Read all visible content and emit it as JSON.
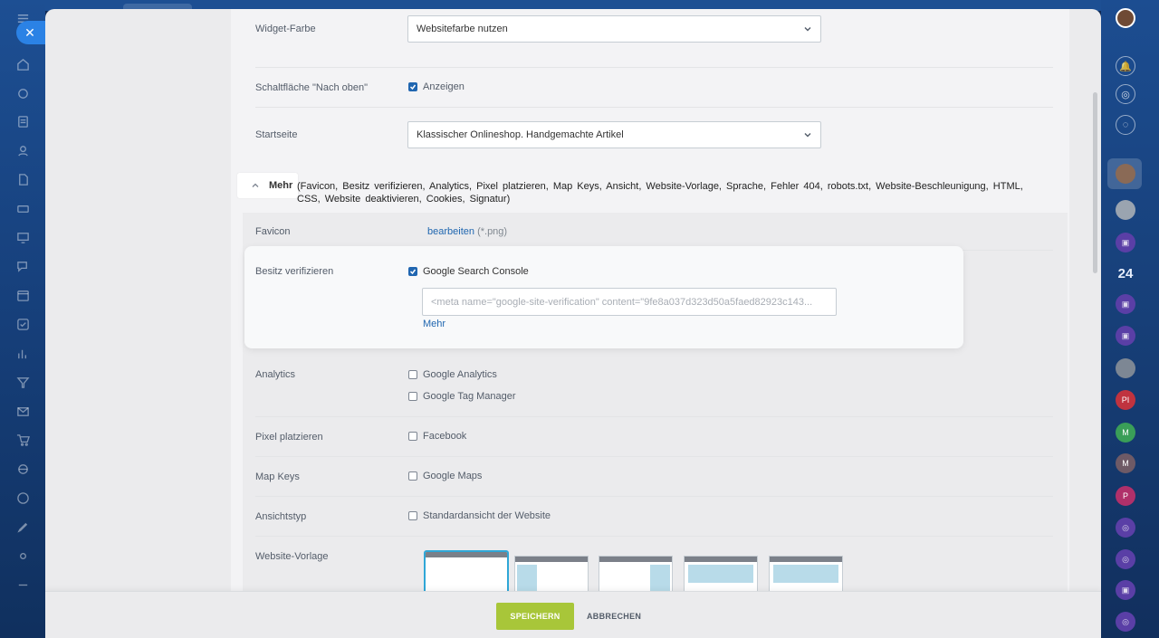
{
  "rows": {
    "widget_color": {
      "label": "Widget-Farbe",
      "value": "Websitefarbe nutzen"
    },
    "back_to_top": {
      "label": "Schaltfläche \"Nach oben\"",
      "checkbox_label": "Anzeigen",
      "checked": true
    },
    "start_page": {
      "label": "Startseite",
      "value": "Klassischer Onlineshop. Handgemachte Artikel"
    }
  },
  "more": {
    "toggle_label": "Mehr",
    "summary": "(Favicon, Besitz verifizieren, Analytics, Pixel platzieren, Map Keys, Ansicht, Website-Vorlage, Sprache, Fehler 404, robots.txt, Website-Beschleunigung, HTML, CSS, Website deaktivieren, Cookies, Signatur)"
  },
  "favicon": {
    "label": "Favicon",
    "link": "bearbeiten",
    "hint": "(*.png)"
  },
  "verify": {
    "label": "Besitz verifizieren",
    "checkbox_label": "Google Search Console",
    "checked": true,
    "meta_value": "<meta name=\"google-site-verification\" content=\"9fe8a037d323d50a5faed82923c143...",
    "more_link": "Mehr"
  },
  "analytics": {
    "label": "Analytics",
    "options": [
      "Google Analytics",
      "Google Tag Manager"
    ]
  },
  "pixel": {
    "label": "Pixel platzieren",
    "option": "Facebook"
  },
  "map_keys": {
    "label": "Map Keys",
    "option": "Google Maps"
  },
  "view_type": {
    "label": "Ansichtstyp",
    "option": "Standardansicht der Website"
  },
  "template": {
    "label": "Website-Vorlage",
    "selected_index": 0
  },
  "footer": {
    "save_label": "SPEICHERN",
    "cancel_label": "ABBRECHEN"
  },
  "sidebar_right": {
    "counter": "24",
    "avatars": [
      "PI",
      "M",
      "M",
      "P"
    ]
  },
  "colors": {
    "link": "#2067b0",
    "accent_save": "#a8c639",
    "checkbox": "#2066b0",
    "template_selected": "#2fa7d7"
  }
}
